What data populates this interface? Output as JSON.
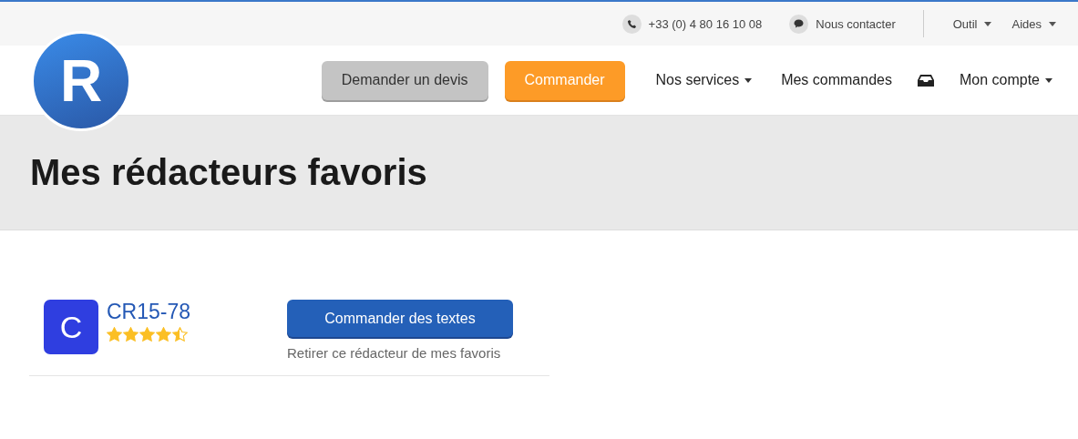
{
  "top_bar": {
    "phone": "+33 (0) 4 80 16 10 08",
    "contact": "Nous contacter",
    "menus": [
      "Outil",
      "Aides"
    ]
  },
  "logo": {
    "letter": "R"
  },
  "nav": {
    "buttons": [
      {
        "label": "Demander un devis",
        "kind": "secondary"
      },
      {
        "label": "Commander",
        "kind": "primary"
      }
    ],
    "links": [
      {
        "label": "Nos services",
        "kind": "dropdown"
      },
      {
        "label": "Mes commandes",
        "kind": "link"
      },
      {
        "kind": "inbox"
      },
      {
        "label": "Mon compte",
        "kind": "dropdown"
      }
    ]
  },
  "page_title": "Mes rédacteurs favoris",
  "writers": [
    {
      "initial": "C",
      "name": "CR15-78",
      "stars": 4.5,
      "order_button": "Commander des textes",
      "remove_link": "Retirer ce rédacteur de mes favoris"
    }
  ]
}
